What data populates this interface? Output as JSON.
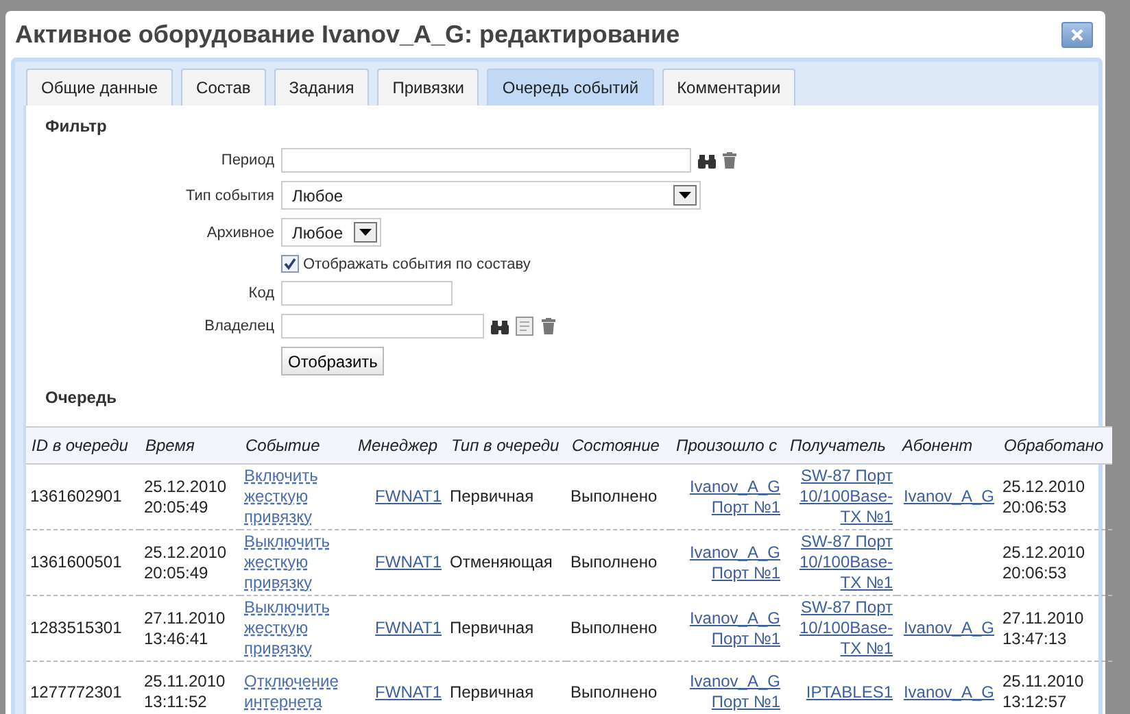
{
  "window": {
    "title": "Активное оборудование Ivanov_A_G: редактирование"
  },
  "tabs": [
    {
      "label": "Общие данные",
      "selected": false
    },
    {
      "label": "Состав",
      "selected": false
    },
    {
      "label": "Задания",
      "selected": false
    },
    {
      "label": "Привязки",
      "selected": false
    },
    {
      "label": "Очередь событий",
      "selected": true
    },
    {
      "label": "Комментарии",
      "selected": false
    }
  ],
  "filter": {
    "heading": "Фильтр",
    "period": {
      "label": "Период"
    },
    "event_type": {
      "label": "Тип события",
      "value": "Любое"
    },
    "archive": {
      "label": "Архивное",
      "value": "Любое"
    },
    "show_by_composition": {
      "label": "Отображать события по составу",
      "checked": true
    },
    "code": {
      "label": "Код"
    },
    "owner": {
      "label": "Владелец"
    },
    "submit": "Отобразить"
  },
  "queue": {
    "heading": "Очередь",
    "columns": [
      "ID в очереди",
      "Время",
      "Событие",
      "Менеджер",
      "Тип в очереди",
      "Состояние",
      "Произошло с",
      "Получатель",
      "Абонент",
      "Обработано"
    ],
    "rows": [
      {
        "id": "1361602901",
        "time": "25.12.2010 20:05:49",
        "event": "Включить жесткую привязку",
        "manager": "FWNAT1",
        "queue_type": "Первичная",
        "state": "Выполнено",
        "source": "Ivanov_A_G Порт №1",
        "recipient": "SW-87 Порт 10/100Base-TX №1",
        "subscriber": "Ivanov_A_G",
        "processed": "25.12.2010 20:06:53"
      },
      {
        "id": "1361600501",
        "time": "25.12.2010 20:05:49",
        "event": "Выключить жесткую привязку",
        "manager": "FWNAT1",
        "queue_type": "Отменяющая",
        "state": "Выполнено",
        "source": "Ivanov_A_G Порт №1",
        "recipient": "SW-87 Порт 10/100Base-TX №1",
        "processed": "25.12.2010 20:06:53"
      },
      {
        "id": "1283515301",
        "time": "27.11.2010 13:46:41",
        "event": "Выключить жесткую привязку",
        "manager": "FWNAT1",
        "queue_type": "Первичная",
        "state": "Выполнено",
        "source": "Ivanov_A_G Порт №1",
        "recipient": "SW-87 Порт 10/100Base-TX №1",
        "subscriber": "Ivanov_A_G",
        "processed": "27.11.2010 13:47:13"
      },
      {
        "id": "1277772301",
        "time": "25.11.2010 13:11:52",
        "event": "Отключение интернета",
        "manager": "FWNAT1",
        "queue_type": "Первичная",
        "state": "Выполнено",
        "source": "Ivanov_A_G Порт №1",
        "recipient": "IPTABLES1",
        "subscriber": "Ivanov_A_G",
        "processed": "25.11.2010 13:12:57"
      }
    ]
  }
}
